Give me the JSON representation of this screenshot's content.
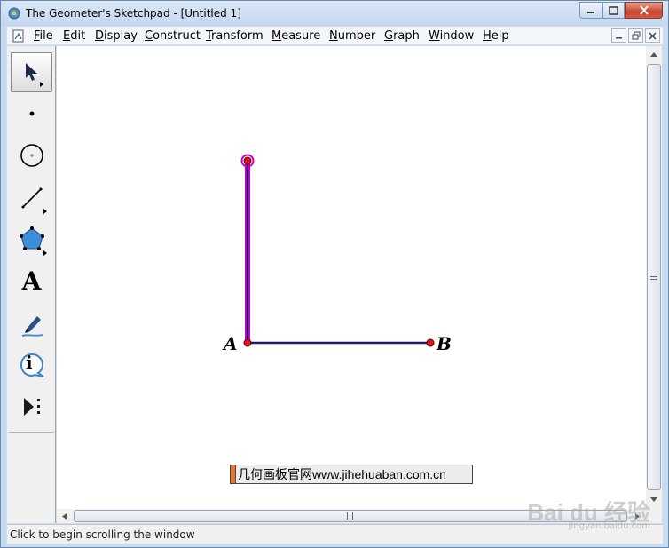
{
  "window": {
    "title": "The Geometer's Sketchpad - [Untitled 1]"
  },
  "menu": [
    {
      "first": "F",
      "rest": "ile"
    },
    {
      "first": "E",
      "rest": "dit"
    },
    {
      "first": "D",
      "rest": "isplay"
    },
    {
      "first": "C",
      "rest": "onstruct"
    },
    {
      "first": "T",
      "rest": "ransform"
    },
    {
      "first": "M",
      "rest": "easure"
    },
    {
      "first": "N",
      "rest": "umber"
    },
    {
      "first": "G",
      "rest": "raph"
    },
    {
      "first": "W",
      "rest": "indow"
    },
    {
      "first": "H",
      "rest": "elp"
    }
  ],
  "toolbox": {
    "tools": [
      "arrow-selection-tool",
      "point-tool",
      "compass-tool",
      "straightedge-tool",
      "polygon-tool",
      "text-tool",
      "marker-tool",
      "information-tool",
      "custom-tools"
    ],
    "text_tool_glyph": "A",
    "info_tool_glyph": "i",
    "active": "arrow-selection-tool"
  },
  "canvas": {
    "labels": {
      "a": "A",
      "b": "B"
    },
    "watermark": "几何画板官网www.jihehuaban.com.cn",
    "segment_color": "#1a1a6e",
    "point_color": "#e0141e",
    "selected_color": "#c000c0"
  },
  "status": {
    "text": "Click to begin scrolling the window"
  },
  "overlay": {
    "brand": "Bai du 经验",
    "sub": "jingyan.baidu.com"
  }
}
